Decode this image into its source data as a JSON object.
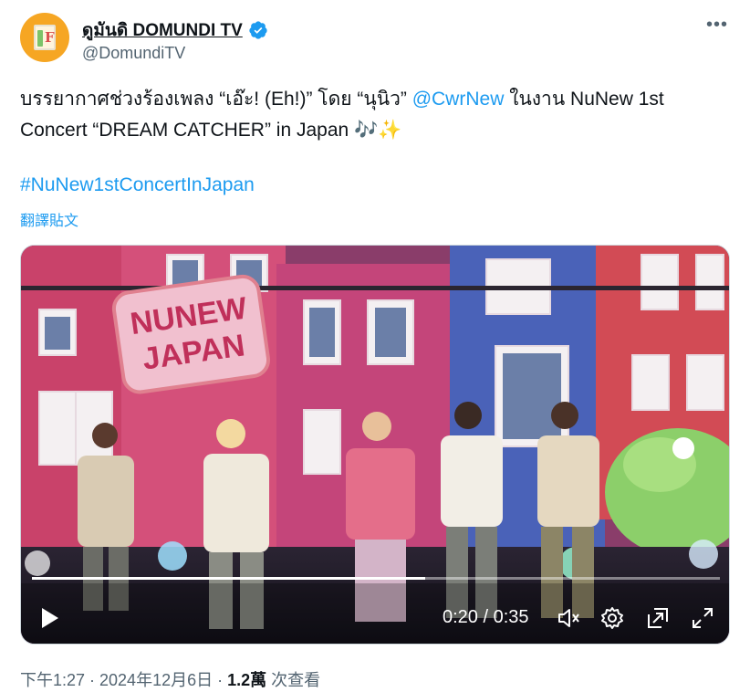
{
  "author": {
    "display_name": "ดูมันดิ DOMUNDI TV",
    "handle": "@DomundiTV",
    "verified": true
  },
  "tweet": {
    "text_part1": "บรรยากาศช่วงร้องเพลง “เอ๊ะ! (Eh!)” โดย “นุนิว” ",
    "mention": "@CwrNew",
    "text_part2": " ในงาน NuNew 1st Concert “DREAM CATCHER” in Japan 🎶✨",
    "hashtag": "#NuNew1stConcertInJapan",
    "translate_label": "翻譯貼文"
  },
  "video": {
    "sign_line1": "NUNEW",
    "sign_line2": "JAPAN",
    "progress_fraction": 0.571,
    "current_time": "0:20",
    "duration": "0:35",
    "time_display": "0:20 / 0:35"
  },
  "meta": {
    "time": "下午1:27 · 2024年12月6日 · ",
    "views_count": "1.2萬",
    "views_label": " 次查看"
  },
  "colors": {
    "link": "#1d9bf0",
    "secondary_text": "#536471",
    "avatar_bg": "#f6a623"
  }
}
